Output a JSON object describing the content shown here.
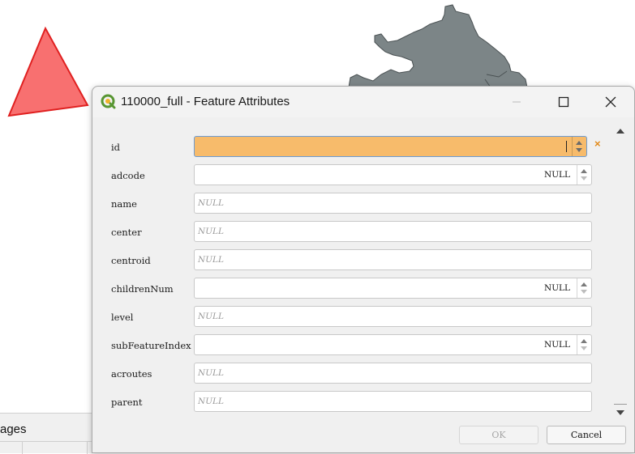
{
  "window": {
    "title": "110000_full - Feature Attributes"
  },
  "background": {
    "panel_label": "ages",
    "triangle_fill": "#f87070",
    "triangle_stroke": "#e02020",
    "region_fill": "#7c8587"
  },
  "form": {
    "fields": [
      {
        "label": "id",
        "value": "",
        "placeholder": "",
        "kind": "spinbox",
        "active": true
      },
      {
        "label": "adcode",
        "value": "NULL",
        "placeholder": "",
        "kind": "spinbox"
      },
      {
        "label": "name",
        "value": "",
        "placeholder": "NULL",
        "kind": "text"
      },
      {
        "label": "center",
        "value": "",
        "placeholder": "NULL",
        "kind": "text"
      },
      {
        "label": "centroid",
        "value": "",
        "placeholder": "NULL",
        "kind": "text"
      },
      {
        "label": "childrenNum",
        "value": "NULL",
        "placeholder": "",
        "kind": "spinbox"
      },
      {
        "label": "level",
        "value": "",
        "placeholder": "NULL",
        "kind": "text"
      },
      {
        "label": "subFeatureIndex",
        "value": "NULL",
        "placeholder": "",
        "kind": "spinbox"
      },
      {
        "label": "acroutes",
        "value": "",
        "placeholder": "NULL",
        "kind": "text"
      },
      {
        "label": "parent",
        "value": "",
        "placeholder": "NULL",
        "kind": "text"
      }
    ],
    "reset_glyph": "×"
  },
  "buttons": {
    "ok_label": "OK",
    "cancel_label": "Cancel"
  }
}
